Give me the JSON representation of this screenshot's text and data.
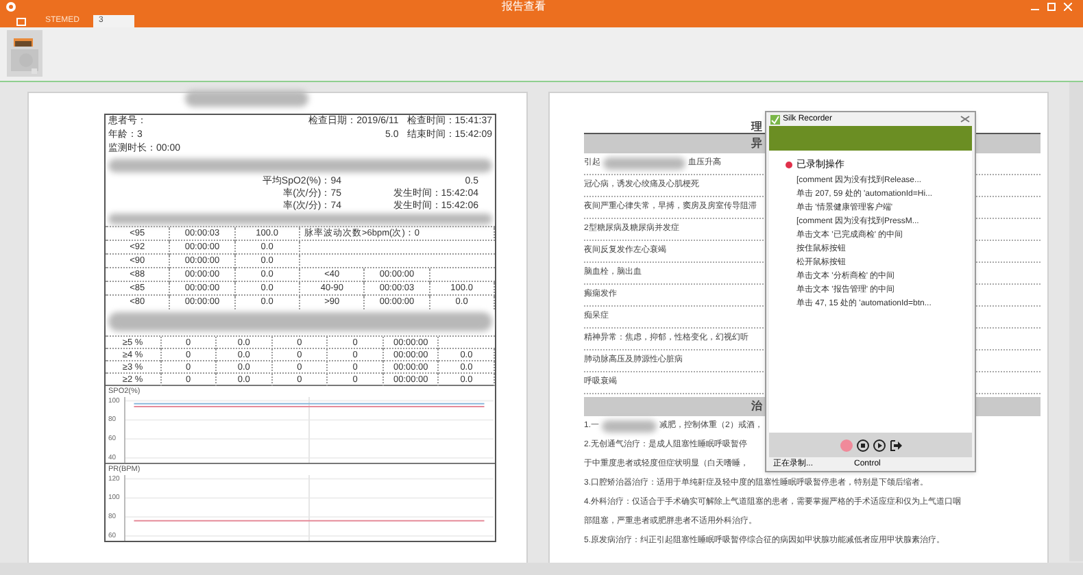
{
  "window": {
    "title": "报告查看"
  },
  "tabs": [
    {
      "kind": "icon",
      "selected": false
    },
    {
      "kind": "text",
      "label": "STEMED",
      "selected": false
    },
    {
      "kind": "text",
      "label": "3",
      "selected": true
    }
  ],
  "report": {
    "header_rows": [
      [
        "患者号：",
        "检查日期：2019/6/11",
        "检查时间：15:41:37"
      ],
      [
        "年龄：3",
        "5.0",
        "结束时间：15:42:09"
      ],
      [
        "监测时长：00:00"
      ]
    ],
    "stat_rows": [
      [
        "平均SpO2(%)：94",
        "0.5"
      ],
      [
        "率(次/分)：75",
        "发生时间：15:42:04"
      ],
      [
        "率(次/分)：74",
        "发生时间：15:42:06"
      ]
    ],
    "spo2_rows": [
      [
        "<95",
        "00:00:03",
        "100.0",
        "脉率波动次数>6bpm(次)：0"
      ],
      [
        "<92",
        "00:00:00",
        "0.0"
      ],
      [
        "<90",
        "00:00:00",
        "0.0"
      ],
      [
        "<88",
        "00:00:00",
        "0.0",
        "<40",
        "00:00:00"
      ],
      [
        "<85",
        "00:00:00",
        "0.0",
        "40-90",
        "00:00:03",
        "100.0"
      ],
      [
        "<80",
        "00:00:00",
        "0.0",
        ">90",
        "00:00:00",
        "0.0"
      ]
    ],
    "desat_rows": [
      [
        "≥5 %",
        "0",
        "0.0",
        "0",
        "0",
        "00:00:00"
      ],
      [
        "≥4 %",
        "0",
        "0.0",
        "0",
        "0",
        "00:00:00",
        "0.0"
      ],
      [
        "≥3 %",
        "0",
        "0.0",
        "0",
        "0",
        "00:00:00",
        "0.0"
      ],
      [
        "≥2 %",
        "0",
        "0.0",
        "0",
        "0",
        "00:00:00",
        "0.0"
      ]
    ],
    "charts": [
      {
        "label": "SPO2(%)",
        "chart_data": {
          "type": "line",
          "grid": true,
          "ylim": [
            35,
            104
          ],
          "yticks": [
            100,
            80,
            60,
            40
          ],
          "series": [
            {
              "color": "#8ab8dc",
              "values": [
                97,
                97,
                97,
                97,
                97,
                97,
                97,
                97,
                97,
                97,
                97,
                97,
                97,
                97,
                97,
                97,
                97,
                97,
                97,
                97
              ]
            },
            {
              "color": "#e58a99",
              "values": [
                94,
                94,
                94,
                94,
                94,
                94,
                94,
                94,
                94,
                94,
                94,
                94,
                94,
                94,
                94,
                94,
                94,
                94,
                94,
                94
              ]
            }
          ]
        }
      },
      {
        "label": "PR(BPM)",
        "chart_data": {
          "type": "line",
          "grid": true,
          "ylim": [
            55,
            124
          ],
          "yticks": [
            120,
            100,
            80,
            60
          ],
          "series": [
            {
              "color": "#e58a99",
              "values": [
                76,
                76,
                76,
                76,
                76,
                76,
                76,
                76,
                76,
                76,
                76,
                76,
                76,
                76,
                76,
                76,
                76,
                76,
                76,
                76
              ]
            }
          ]
        }
      }
    ]
  },
  "advice": {
    "title_fragment": "理",
    "section_1_fragment": "异",
    "risk_rows": [
      [
        "引起",
        "血压升高"
      ],
      [
        "冠心病，诱发心绞痛及心肌梗死"
      ],
      [
        "夜间严重心律失常，早搏，窦房及房室传导阻滞"
      ],
      [
        "2型糖尿病及糖尿病并发症"
      ],
      [
        "夜间反复发作左心衰竭"
      ],
      [
        "脑血栓，脑出血"
      ],
      [
        "癫痫发作"
      ],
      [
        "痴呆症"
      ],
      [
        "精神异常：焦虑，抑郁，性格变化，幻视幻听"
      ],
      [
        "肺动脉高压及肺源性心脏病"
      ],
      [
        "呼吸衰竭"
      ]
    ],
    "section_2_fragment": "治",
    "short_lines": [
      [
        "1.一",
        "减肥，控制体重（2）戒酒，"
      ],
      [
        "2.无创通气治疗：是成人阻塞性睡眠呼吸暂停"
      ],
      [
        "于中重度患者或轻度但症状明显（白天嗜睡，"
      ]
    ],
    "lines": [
      "3.口腔矫治器治疗：适用于单纯鼾症及轻中度的阻塞性睡眠呼吸暂停患者，特别是下颌后缩者。",
      "4.外科治疗：仅适合于手术确实可解除上气道阻塞的患者，需要掌握严格的手术适应症和仅为上气道口咽",
      "部阻塞，严重患者或肥胖患者不适用外科治疗。",
      "5.原发病治疗：纠正引起阻塞性睡眠呼吸暂停综合征的病因如甲状腺功能减低者应用甲状腺素治疗。"
    ]
  },
  "recorder": {
    "title": "Silk Recorder",
    "heading": "已录制操作",
    "steps": [
      "[comment 因为没有找到Release...",
      "单击 207, 59 处的 'automationId=Hi...",
      "单击 '情景健康管理客户端'",
      "[comment 因为没有找到PressM...",
      "单击文本 '已完成商检' 的中间",
      "按住鼠标按钮",
      "松开鼠标按钮",
      "单击文本 '分析商检' 的中间",
      "单击文本 '报告管理' 的中间",
      "单击 47, 15 处的 'automationId=btn..."
    ],
    "controls": [
      {
        "kind": "record"
      },
      {
        "kind": "stop"
      },
      {
        "kind": "play"
      },
      {
        "kind": "exit"
      }
    ],
    "status": "正在录制...",
    "mode": "Control"
  }
}
